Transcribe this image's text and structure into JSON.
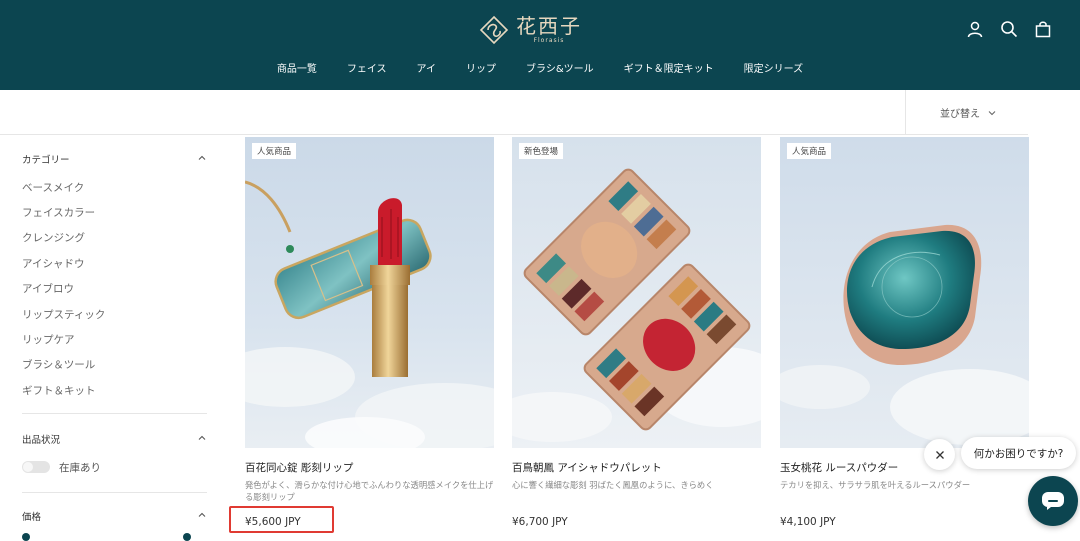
{
  "brand": {
    "name_cn": "花西子",
    "name_en": "Florasis"
  },
  "nav": [
    "商品一覧",
    "フェイス",
    "アイ",
    "リップ",
    "ブラシ&ツール",
    "ギフト＆限定キット",
    "限定シリーズ"
  ],
  "header_icons": [
    "account-icon",
    "search-icon",
    "cart-icon"
  ],
  "sort": {
    "label": "並び替え"
  },
  "sidebar": {
    "category": {
      "title": "カテゴリー",
      "items": [
        "ベースメイク",
        "フェイスカラー",
        "クレンジング",
        "アイシャドウ",
        "アイブロウ",
        "リップスティック",
        "リップケア",
        "ブラシ＆ツール",
        "ギフト＆キット"
      ]
    },
    "availability": {
      "title": "出品状況",
      "option": "在庫あり"
    },
    "price": {
      "title": "価格"
    }
  },
  "products": [
    {
      "badge": "人気商品",
      "name": "百花同心錠 彫刻リップ",
      "desc": "発色がよく、滑らかな付け心地でふんわりな透明感メイクを仕上げる彫刻リップ",
      "price": "¥5,600 JPY"
    },
    {
      "badge": "新色登場",
      "name": "百鳥朝鳳 アイシャドウパレット",
      "desc": "心に響く繊細な彫刻 羽ばたく鳳凰のように、きらめく",
      "price": "¥6,700 JPY"
    },
    {
      "badge": "人気商品",
      "name": "玉女桃花 ルースパウダー",
      "desc": "テカリを抑え、サラサラ肌を叶えるルースパウダー",
      "price": "¥4,100 JPY"
    }
  ],
  "chat": {
    "prompt": "何かお困りですか?"
  },
  "colors": {
    "header_bg": "#0c4550",
    "logo_gold": "#e7d8bf",
    "highlight": "#e03a32"
  }
}
